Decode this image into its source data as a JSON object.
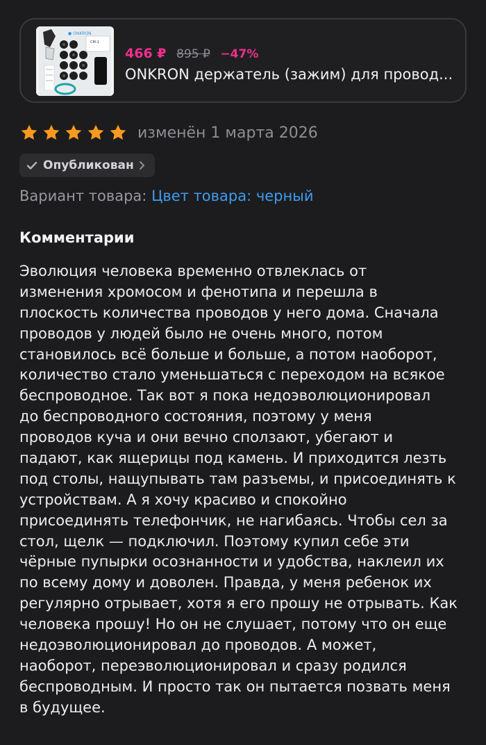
{
  "product": {
    "price_current": "466 ₽",
    "price_old": "895 ₽",
    "discount": "−47%",
    "title": "ONKRON держатель (зажим) для провод..."
  },
  "review": {
    "rating": 5,
    "rating_max": 5,
    "star_color": "#f79a1f",
    "date_text": "изменён 1 марта 2026",
    "status_label": "Опубликован",
    "variant_label": "Вариант товара:",
    "variant_value": "Цвет товара: черный"
  },
  "comments": {
    "title": "Комментарии",
    "lines": [
      "Эволюция человека временно отвлеклась от",
      "изменения хромосом и фенотипа и перешла в",
      "плоскость количества проводов у него дома. Сначала",
      "проводов у людей было не очень много, потом",
      "становилось всё больше и больше, а потом наоборот,",
      "количество стало уменьшаться с переходом на всякое",
      "беспроводное. Так вот я пока недоэволюционировал",
      "до беспроводного состояния, поэтому у меня",
      "проводов куча и они вечно сползают, убегают и",
      "падают, как ящерицы под камень. И приходится лезть",
      "под столы, нащупывать там разъемы, и присоединять к",
      "устройствам. А я хочу красиво и спокойно",
      "присоединять телефончик, не нагибаясь. Чтобы сел за",
      "стол, щелк — подключил. Поэтому купил себе эти",
      "чёрные пупырки осознанности и удобства, наклеил их",
      "по всему дому и доволен. Правда, у меня ребенок их",
      "регулярно отрывает, хотя я его прошу не отрывать. Как",
      "человека прошу! Но он не слушает, потому что он еще",
      "недоэволюционировал до проводов. А может,",
      "наоборот, переэволюционировал и сразу родился",
      "беспроводным. И просто так он пытается позвать меня",
      "в будущее."
    ]
  },
  "icons": {
    "star": "star-icon",
    "check": "check-icon",
    "chevron": "chevron-right-icon"
  }
}
